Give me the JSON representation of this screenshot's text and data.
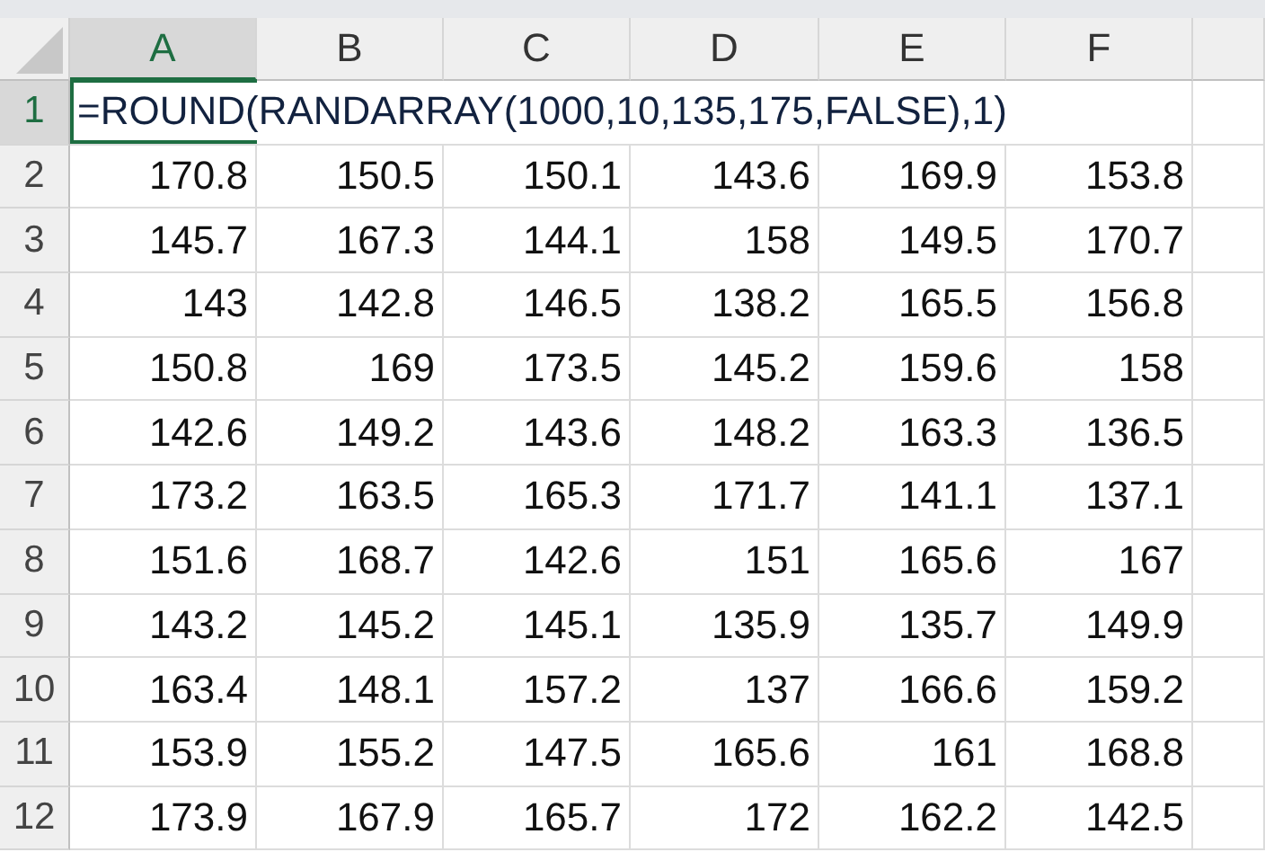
{
  "columns": [
    {
      "label": "A",
      "selected": true
    },
    {
      "label": "B",
      "selected": false
    },
    {
      "label": "C",
      "selected": false
    },
    {
      "label": "D",
      "selected": false
    },
    {
      "label": "E",
      "selected": false
    },
    {
      "label": "F",
      "selected": false
    }
  ],
  "editing": {
    "row": "1",
    "selected": true,
    "formula": "=ROUND(RANDARRAY(1000,10,135,175,FALSE),1)"
  },
  "rows": [
    {
      "label": "2",
      "selected": false,
      "cells": [
        "170.8",
        "150.5",
        "150.1",
        "143.6",
        "169.9",
        "153.8"
      ]
    },
    {
      "label": "3",
      "selected": false,
      "cells": [
        "145.7",
        "167.3",
        "144.1",
        "158",
        "149.5",
        "170.7"
      ]
    },
    {
      "label": "4",
      "selected": false,
      "cells": [
        "143",
        "142.8",
        "146.5",
        "138.2",
        "165.5",
        "156.8"
      ]
    },
    {
      "label": "5",
      "selected": false,
      "cells": [
        "150.8",
        "169",
        "173.5",
        "145.2",
        "159.6",
        "158"
      ]
    },
    {
      "label": "6",
      "selected": false,
      "cells": [
        "142.6",
        "149.2",
        "143.6",
        "148.2",
        "163.3",
        "136.5"
      ]
    },
    {
      "label": "7",
      "selected": false,
      "cells": [
        "173.2",
        "163.5",
        "165.3",
        "171.7",
        "141.1",
        "137.1"
      ]
    },
    {
      "label": "8",
      "selected": false,
      "cells": [
        "151.6",
        "168.7",
        "142.6",
        "151",
        "165.6",
        "167"
      ]
    },
    {
      "label": "9",
      "selected": false,
      "cells": [
        "143.2",
        "145.2",
        "145.1",
        "135.9",
        "135.7",
        "149.9"
      ]
    },
    {
      "label": "10",
      "selected": false,
      "cells": [
        "163.4",
        "148.1",
        "157.2",
        "137",
        "166.6",
        "159.2"
      ]
    },
    {
      "label": "11",
      "selected": false,
      "cells": [
        "153.9",
        "155.2",
        "147.5",
        "165.6",
        "161",
        "168.8"
      ]
    },
    {
      "label": "12",
      "selected": false,
      "cells": [
        "173.9",
        "167.9",
        "165.7",
        "172",
        "162.2",
        "142.5"
      ]
    }
  ]
}
